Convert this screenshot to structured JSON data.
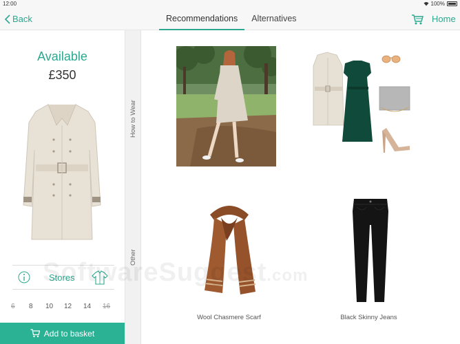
{
  "status_bar": {
    "time": "12:00",
    "battery": "100%"
  },
  "nav": {
    "back_label": "Back",
    "tabs": [
      {
        "label": "Recommendations",
        "active": true
      },
      {
        "label": "Alternatives",
        "active": false
      }
    ],
    "home_label": "Home"
  },
  "product": {
    "availability": "Available",
    "price": "£350",
    "stores_label": "Stores",
    "sizes": [
      {
        "label": "6",
        "available": false
      },
      {
        "label": "8",
        "available": true
      },
      {
        "label": "10",
        "available": true
      },
      {
        "label": "12",
        "available": true
      },
      {
        "label": "14",
        "available": true
      },
      {
        "label": "16",
        "available": false
      }
    ],
    "add_to_basket_label": "Add to basket"
  },
  "sections": {
    "how_to_wear": "How to Wear",
    "other": "Other"
  },
  "recommendations": {
    "items": [
      {
        "caption": "Wool Chasmere Scarf"
      },
      {
        "caption": "Black Skinny Jeans"
      }
    ]
  },
  "watermark": {
    "text": "SoftwareSuggest",
    "suffix": ".com"
  },
  "colors": {
    "accent": "#2ba88f",
    "basket": "#2bb295"
  }
}
